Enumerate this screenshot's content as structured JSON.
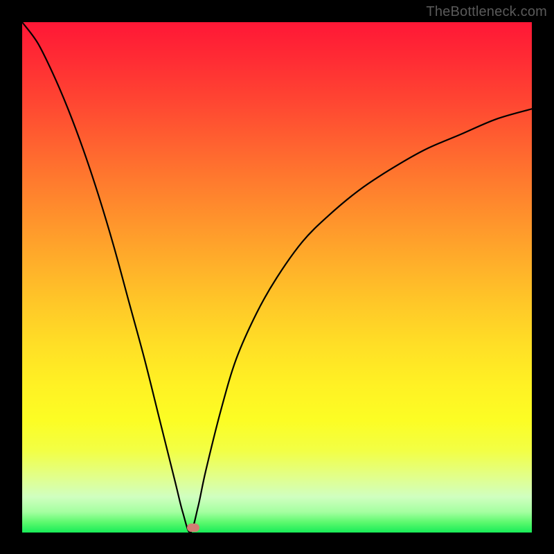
{
  "watermark": "TheBottleneck.com",
  "chart_data": {
    "type": "line",
    "title": "",
    "xlabel": "",
    "ylabel": "",
    "xlim": [
      0,
      1
    ],
    "ylim": [
      0,
      1
    ],
    "minimum": {
      "x": 0.33,
      "y": 0.0
    },
    "marker": {
      "x": 0.335,
      "y": 0.01,
      "color": "#d17e73"
    },
    "left_branch": {
      "x": [
        0.0,
        0.03,
        0.06,
        0.09,
        0.12,
        0.15,
        0.18,
        0.21,
        0.24,
        0.27,
        0.3,
        0.315,
        0.33
      ],
      "y": [
        1.0,
        0.96,
        0.9,
        0.83,
        0.75,
        0.66,
        0.56,
        0.45,
        0.34,
        0.22,
        0.1,
        0.04,
        0.0
      ]
    },
    "right_branch": {
      "x": [
        0.33,
        0.345,
        0.36,
        0.39,
        0.42,
        0.46,
        0.5,
        0.55,
        0.6,
        0.66,
        0.72,
        0.79,
        0.86,
        0.93,
        1.0
      ],
      "y": [
        0.0,
        0.05,
        0.12,
        0.24,
        0.34,
        0.43,
        0.5,
        0.57,
        0.62,
        0.67,
        0.71,
        0.75,
        0.78,
        0.81,
        0.83
      ]
    },
    "background_gradient": {
      "top": "#ff1736",
      "bottom": "#18ec58"
    }
  }
}
